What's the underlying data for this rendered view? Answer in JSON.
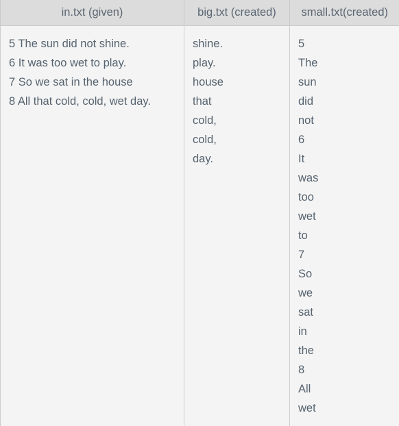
{
  "table": {
    "columns": [
      {
        "header": "in.txt (given)",
        "key": "in_txt"
      },
      {
        "header": "big.txt (created)",
        "key": "big_txt"
      },
      {
        "header": "small.txt(created)",
        "key": "small_txt"
      }
    ],
    "cells": {
      "in_txt": [
        "5 The sun did not shine.",
        "6 It was too wet to play.",
        "7 So we sat in the house",
        "8 All that cold, cold, wet day."
      ],
      "big_txt": [
        "shine.",
        "play.",
        "house",
        "that",
        "cold,",
        "cold,",
        "day."
      ],
      "small_txt": [
        "5",
        "The",
        "sun",
        "did",
        "not",
        "6",
        "It",
        "was",
        "too",
        "wet",
        "to",
        "7",
        "So",
        "we",
        "sat",
        "in",
        "the",
        "8",
        "All",
        "wet"
      ]
    }
  },
  "colors": {
    "header_background": "#dcdcdc",
    "body_background": "#f4f4f4",
    "text": "#56636f",
    "header_text": "#5a6672",
    "border": "#cdcdcd"
  }
}
